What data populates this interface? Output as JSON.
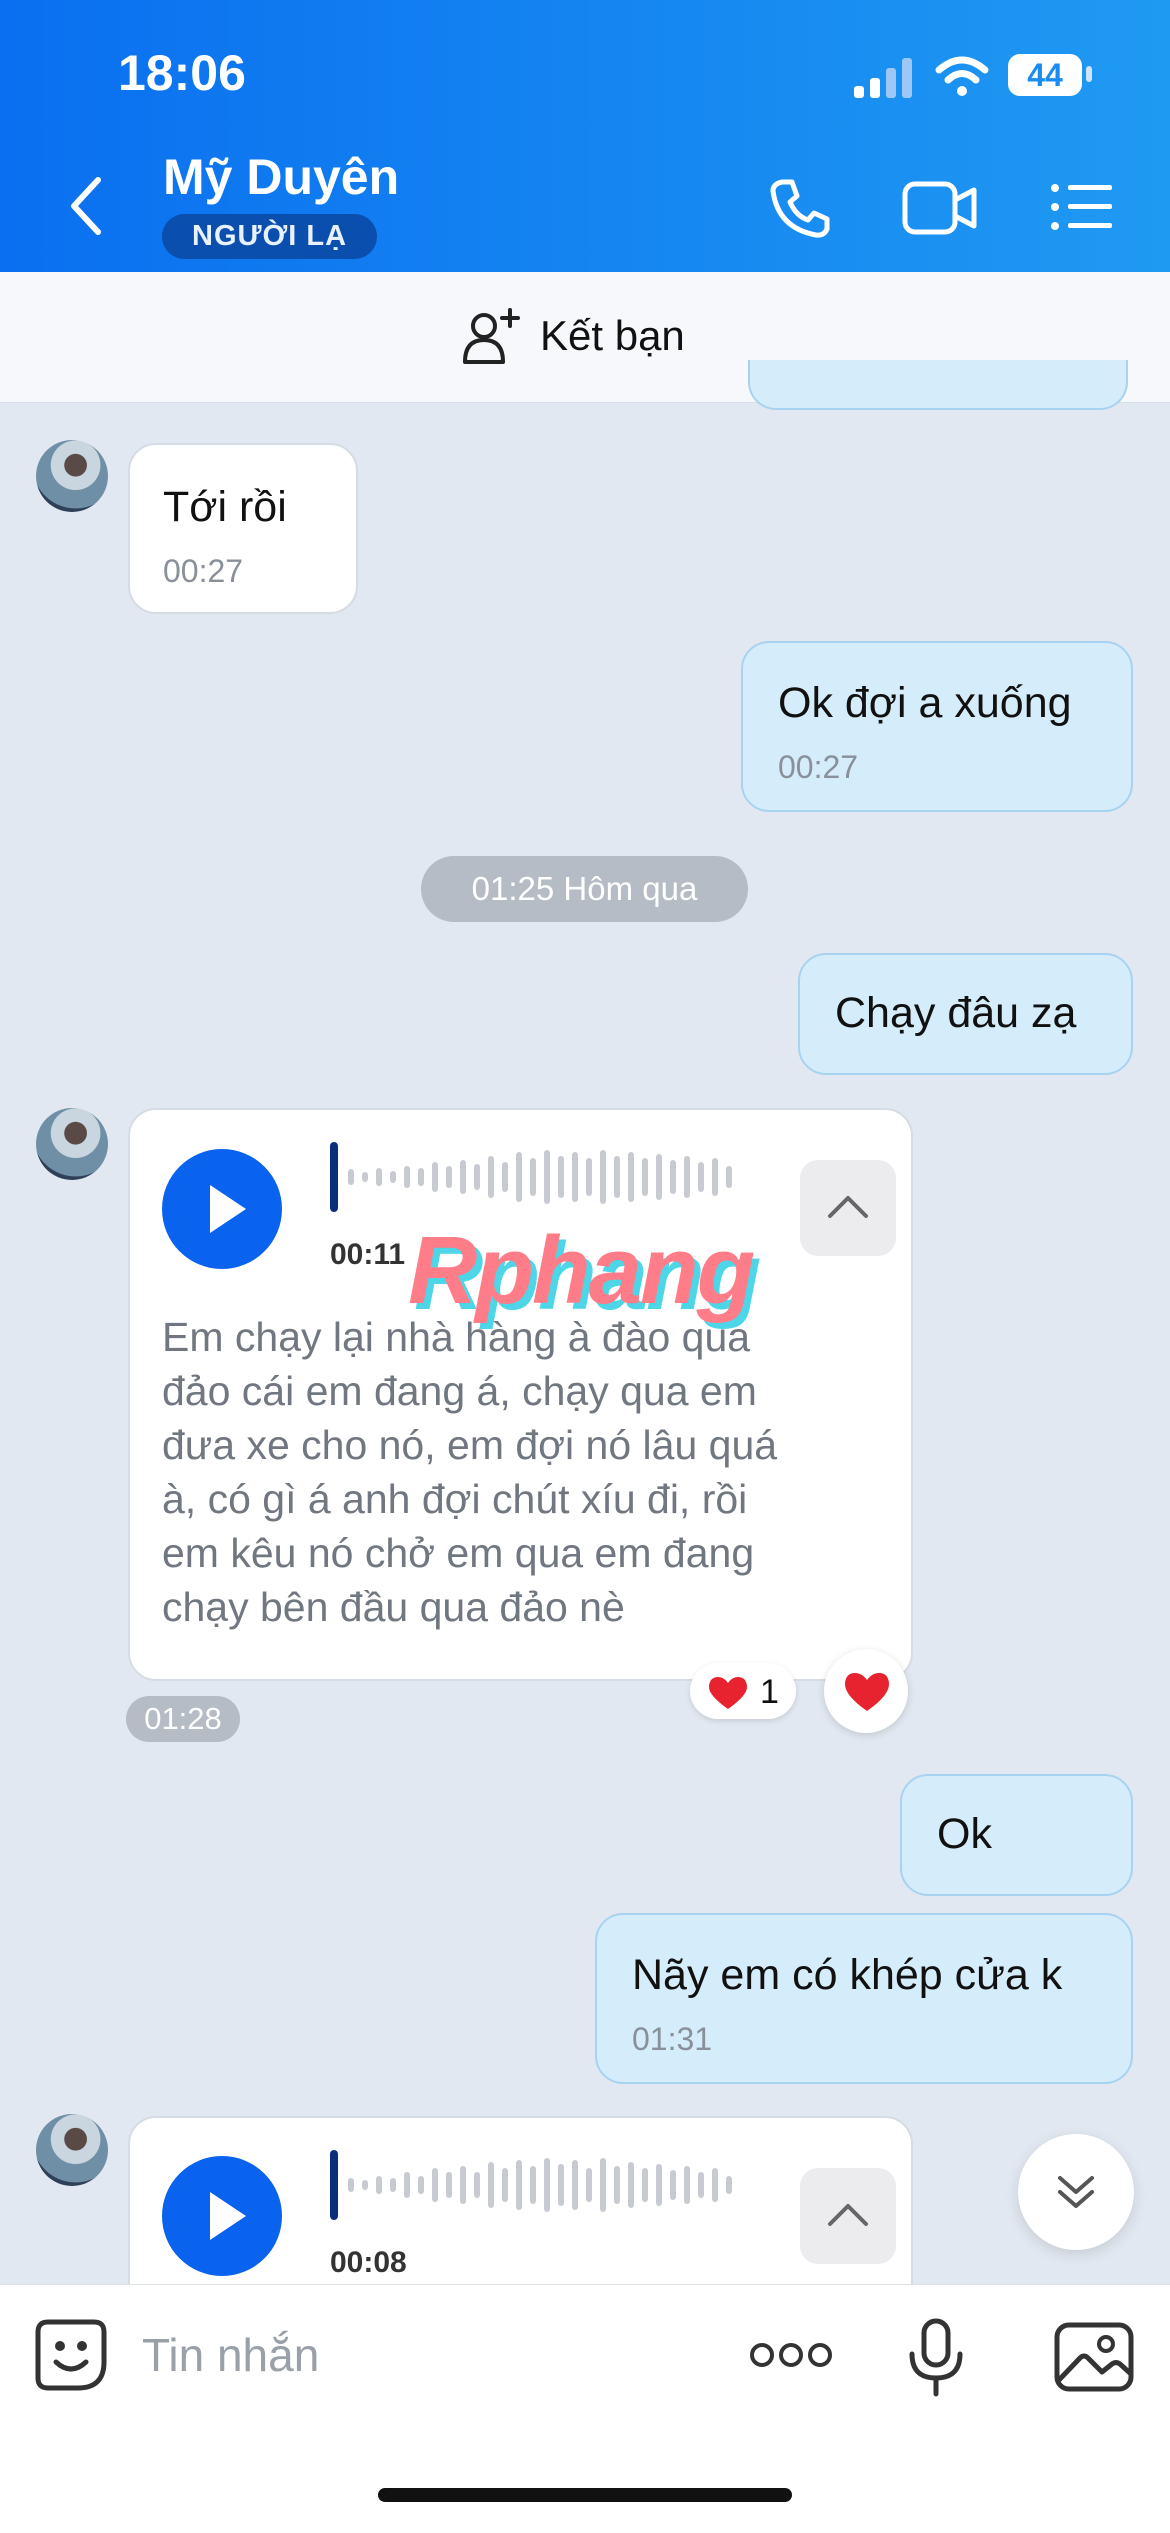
{
  "status_bar": {
    "time": "18:06",
    "battery": "44"
  },
  "header": {
    "contact_name": "Mỹ Duyên",
    "badge": "NGƯỜI LẠ"
  },
  "friend_bar": {
    "label": "Kết bạn"
  },
  "messages": [
    {
      "text": "Tới rồi",
      "time": "00:27"
    },
    {
      "text": "Ok đợi a xuống",
      "time": "00:27"
    },
    {
      "date": "01:25 Hôm qua"
    },
    {
      "text": "Chạy đâu zạ"
    },
    {
      "duration": "00:11",
      "transcript": [
        "Em chạy lại nhà hàng à đào qua",
        "đảo cái em đang á, chạy qua em",
        "đưa xe cho nó, em đợi nó lâu quá",
        "à, có gì á anh đợi chút xíu đi, rồi",
        "em kêu nó chở em qua em đang",
        "chạy bên đầu qua đảo nè"
      ],
      "reaction_count": "1",
      "time": "01:28"
    },
    {
      "text": "Ok"
    },
    {
      "text": "Nãy em có khép cửa k",
      "time": "01:31"
    },
    {
      "duration": "00:08"
    }
  ],
  "watermark": "Rphang",
  "composer": {
    "placeholder": "Tin nhắn"
  },
  "colors": {
    "header": "#0a6ff0",
    "accent": "#0a63ef",
    "outgoing_bubble": "#d5ecfb",
    "background": "#e2e8f1"
  },
  "icons": [
    "back-icon",
    "phone-icon",
    "video-icon",
    "menu-icon",
    "add-friend-icon",
    "play-icon",
    "chevron-up-icon",
    "heart-icon",
    "chevron-double-down-icon",
    "sticker-icon",
    "more-icon",
    "mic-icon",
    "image-icon"
  ]
}
